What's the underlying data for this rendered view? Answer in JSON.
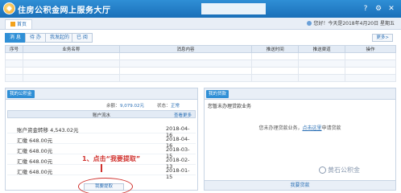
{
  "header": {
    "title": "住房公积金网上服务大厅",
    "icons": [
      "help-icon",
      "settings-icon",
      "close-icon"
    ]
  },
  "nav": {
    "home_tab": "首页",
    "user_greeting": "您好！今天是2018年4月20日 星期五"
  },
  "message_tabs": [
    {
      "label": "消 息",
      "active": true
    },
    {
      "label": "待 办",
      "active": false
    },
    {
      "label": "我发起的",
      "active": false
    },
    {
      "label": "已 阅",
      "active": false
    }
  ],
  "more_label": "更多>",
  "message_table": {
    "columns": [
      "序号",
      "业务名称",
      "消息内容",
      "推送时间",
      "推送渠道",
      "操作"
    ],
    "rows": 4
  },
  "fund_panel": {
    "tag": "我的公积金",
    "balance_label": "余额：",
    "balance_value": "9,079.02元",
    "status_label": "状态：",
    "status_value": "正常",
    "flow_title": "账户流水",
    "flow_more": "查看更多",
    "flow": [
      {
        "desc": "账户资金转移 4,543.02元",
        "date": "2018-04-16"
      },
      {
        "desc": "汇缴 648.00元",
        "date": "2018-04-16"
      },
      {
        "desc": "汇缴 648.00元",
        "date": "2018-03-15"
      },
      {
        "desc": "汇缴 648.00元",
        "date": "2018-02-13"
      },
      {
        "desc": "汇缴 648.00元",
        "date": "2018-01-15"
      }
    ],
    "withdraw_button": "我要提取",
    "annotation": "1、点击“我要提取”"
  },
  "loan_panel": {
    "tag": "我的贷款",
    "title": "您暂未办理贷款业务",
    "empty_text_before": "您未办理贷款业务，",
    "empty_link": "点击这里",
    "empty_text_after": "申请贷款",
    "apply_button": "我要贷款"
  },
  "watermark": "黄石公积金"
}
